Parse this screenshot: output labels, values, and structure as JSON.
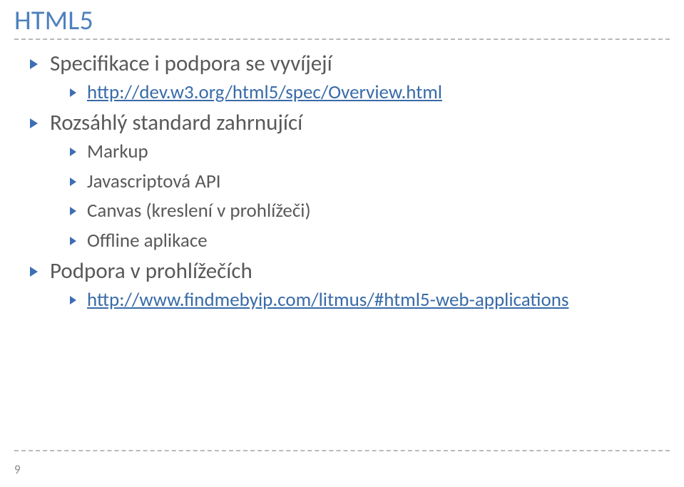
{
  "title": "HTML5",
  "page_number": "9",
  "bullets": [
    {
      "text": "Specifikace i podpora se vyvíjejí",
      "children": [
        {
          "link": "http://dev.w3.org/html5/spec/Overview.html"
        }
      ]
    },
    {
      "text": "Rozsáhlý standard zahrnující",
      "children": [
        {
          "text": "Markup"
        },
        {
          "text": "Javascriptová API"
        },
        {
          "text": "Canvas (kreslení v prohlížeči)"
        },
        {
          "text": "Offline aplikace"
        }
      ]
    },
    {
      "text": "Podpora v prohlížečích",
      "children": [
        {
          "link": "http://www.findmebyip.com/litmus/#html5-web-applications"
        }
      ]
    }
  ]
}
